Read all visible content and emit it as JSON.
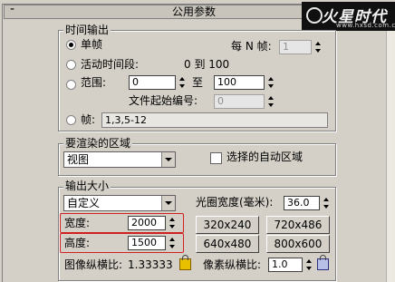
{
  "header": {
    "minus": "-",
    "title": "公用参数"
  },
  "logo": {
    "text": "火星时代",
    "url": "www.hxsd.com.cn"
  },
  "time_output": {
    "title": "时间输出",
    "single_label": "单帧",
    "every_n_label": "每 N 帧:",
    "every_n_value": "1",
    "active_label": "活动时间段:",
    "active_range": "0 到 100",
    "range_label": "范围:",
    "range_from": "0",
    "range_to_label": "至",
    "range_to": "100",
    "file_start_label": "文件起始编号:",
    "file_start_value": "0",
    "frames_label": "帧:",
    "frames_value": "1,3,5-12"
  },
  "render_area": {
    "title": "要渲染的区域",
    "selected": "视图",
    "auto_region_label": "选择的自动区域"
  },
  "output_size": {
    "title": "输出大小",
    "preset": "自定义",
    "aperture_label": "光圈宽度(毫米):",
    "aperture_value": "36.0",
    "width_label": "宽度:",
    "width_value": "2000",
    "height_label": "高度:",
    "height_value": "1500",
    "presets": [
      "320x240",
      "720x486",
      "640x480",
      "800x600"
    ],
    "image_aspect_label": "图像纵横比:",
    "image_aspect_value": "1.33333",
    "pixel_aspect_label": "像素纵横比:",
    "pixel_aspect_value": "1.0"
  },
  "colors": {
    "highlight": "#d02020",
    "background": "#d4d0c8"
  }
}
